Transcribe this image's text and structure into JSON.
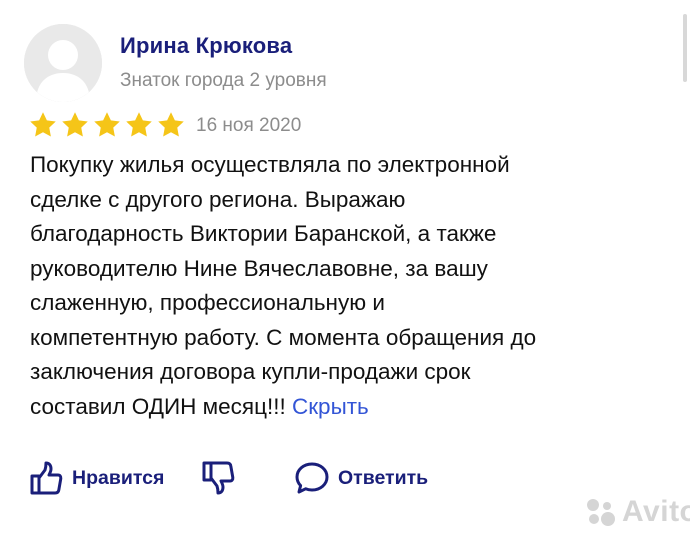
{
  "author": {
    "name": "Ирина Крюкова",
    "level": "Знаток города 2 уровня"
  },
  "review": {
    "rating": 5,
    "rating_max": 5,
    "date": "16 ноя 2020",
    "text": "Покупку жилья осуществляла по электронной\nсделке с другого региона. Выражаю\nблагодарность Виктории Баранской, а также\nруководителю Нине Вячеславовне, за вашу\nслаженную, профессиональную и\nкомпетентную работу. С момента обращения до\nзаключения договора купли-продажи срок\nсоставил ОДИН месяц!!! ",
    "hide_label": "Скрыть"
  },
  "actions": {
    "like_label": "Нравится",
    "reply_label": "Ответить"
  },
  "icons": {
    "avatar": "user-placeholder-icon",
    "star": "star-icon",
    "like": "thumbs-up-icon",
    "dislike": "thumbs-down-icon",
    "reply": "speech-bubble-icon"
  },
  "colors": {
    "name": "#1a1f7a",
    "star": "#f5c518",
    "link": "#3355d6",
    "muted": "#8c8c8c"
  },
  "watermark": "Avito"
}
